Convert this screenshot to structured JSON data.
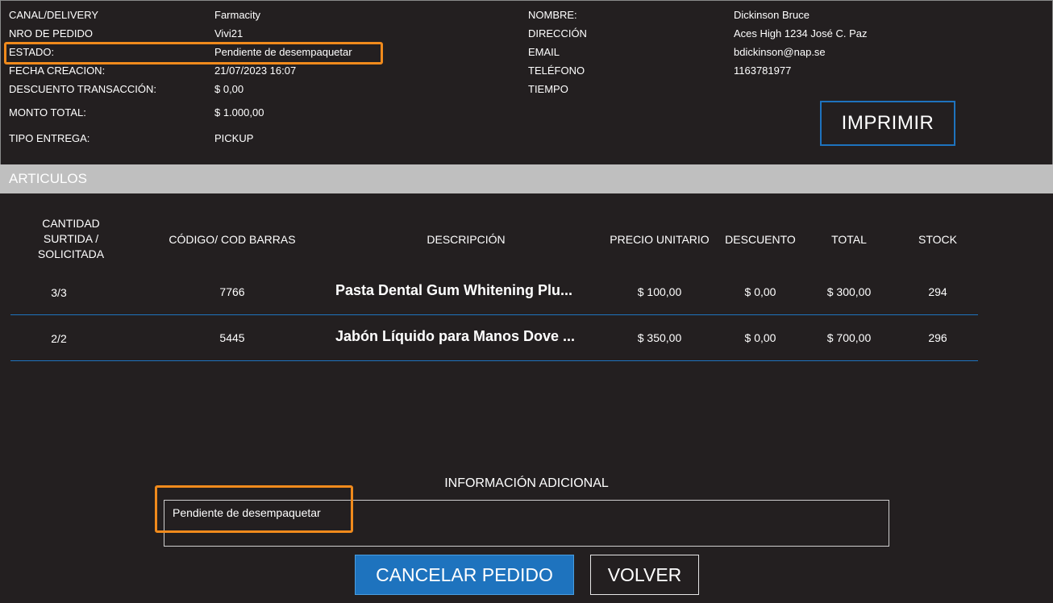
{
  "order": {
    "canal_label": "CANAL/DELIVERY",
    "canal_value": "Farmacity",
    "pedido_label": "NRO DE PEDIDO",
    "pedido_value": "Vivi21",
    "estado_label": "ESTADO:",
    "estado_value": "Pendiente de desempaquetar",
    "fecha_label": "FECHA CREACION:",
    "fecha_value": "21/07/2023 16:07",
    "descuento_label": "DESCUENTO TRANSACCIÓN:",
    "descuento_value": "$ 0,00",
    "monto_label": "MONTO TOTAL:",
    "monto_value": "$ 1.000,00",
    "entrega_label": "TIPO ENTREGA:",
    "entrega_value": "PICKUP"
  },
  "customer": {
    "nombre_label": "NOMBRE:",
    "nombre_value": "Dickinson Bruce",
    "direccion_label": "DIRECCIÓN",
    "direccion_value": "Aces High 1234 José C. Paz",
    "email_label": "EMAIL",
    "email_value": "bdickinson@nap.se",
    "telefono_label": "TELÉFONO",
    "telefono_value": "1163781977",
    "tiempo_label": "TIEMPO"
  },
  "print_button": "IMPRIMIR",
  "section_title": "ARTICULOS",
  "table": {
    "headers": {
      "cantidad": "CANTIDAD SURTIDA / SOLICITADA",
      "codigo": "CÓDIGO/ COD BARRAS",
      "descripcion": "DESCRIPCIÓN",
      "precio": "PRECIO UNITARIO",
      "descuento": "DESCUENTO",
      "total": "TOTAL",
      "stock": "STOCK"
    },
    "rows": [
      {
        "cantidad": "3/3",
        "codigo": "7766",
        "descripcion": "Pasta Dental Gum Whitening Plu...",
        "precio": "$ 100,00",
        "descuento": "$ 0,00",
        "total": "$ 300,00",
        "stock": "294"
      },
      {
        "cantidad": "2/2",
        "codigo": "5445",
        "descripcion": "Jabón Líquido para Manos Dove ...",
        "precio": "$ 350,00",
        "descuento": "$ 0,00",
        "total": "$ 700,00",
        "stock": "296"
      }
    ]
  },
  "info": {
    "title": "INFORMACIÓN ADICIONAL",
    "text": "Pendiente de desempaquetar"
  },
  "buttons": {
    "cancel": "CANCELAR PEDIDO",
    "back": "VOLVER"
  },
  "colors": {
    "background": "#231f20",
    "accent_blue": "#1e73be",
    "highlight_orange": "#f08a1c",
    "section_gray": "#bfbfbf"
  }
}
